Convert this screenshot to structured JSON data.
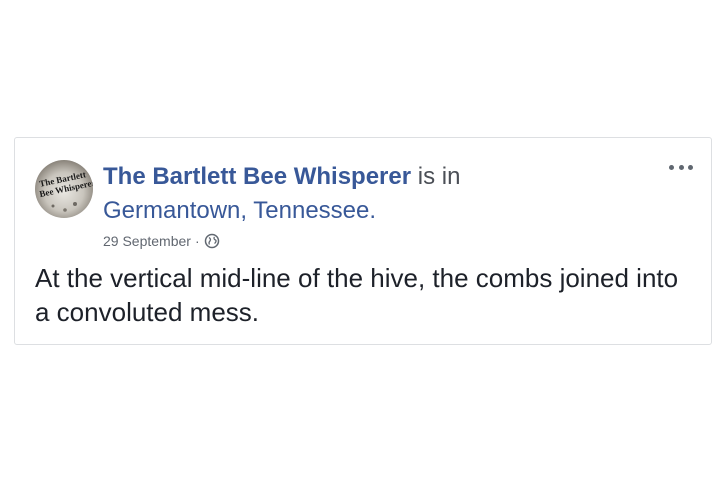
{
  "post": {
    "author": "The Bartlett Bee Whisperer",
    "is_in_text": "is in",
    "location": "Germantown, Tennessee.",
    "timestamp": "29 September",
    "separator": "·",
    "privacy_icon": "globe-icon",
    "menu_icon": "more-options-icon",
    "body": "At the vertical mid-line of the hive, the combs joined into a convoluted mess.",
    "avatar": {
      "logo_text_line1": "The Bartlett",
      "logo_text_line2": "Bee Whisperer"
    }
  },
  "colors": {
    "link_blue": "#385898",
    "text_dark": "#1d2129",
    "meta_gray": "#616770",
    "border": "#dddfe2"
  }
}
